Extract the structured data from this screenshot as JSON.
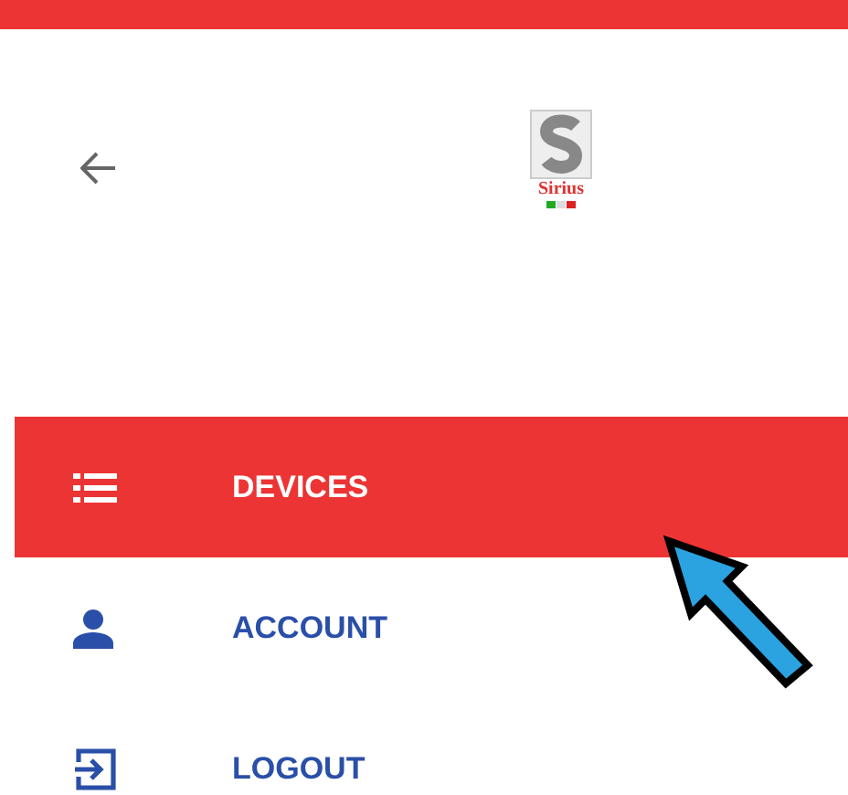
{
  "logo": {
    "text": "Sirius"
  },
  "menu": [
    {
      "label": "DEVICES",
      "selected": true
    },
    {
      "label": "ACCOUNT",
      "selected": false
    },
    {
      "label": "LOGOUT",
      "selected": false
    }
  ]
}
